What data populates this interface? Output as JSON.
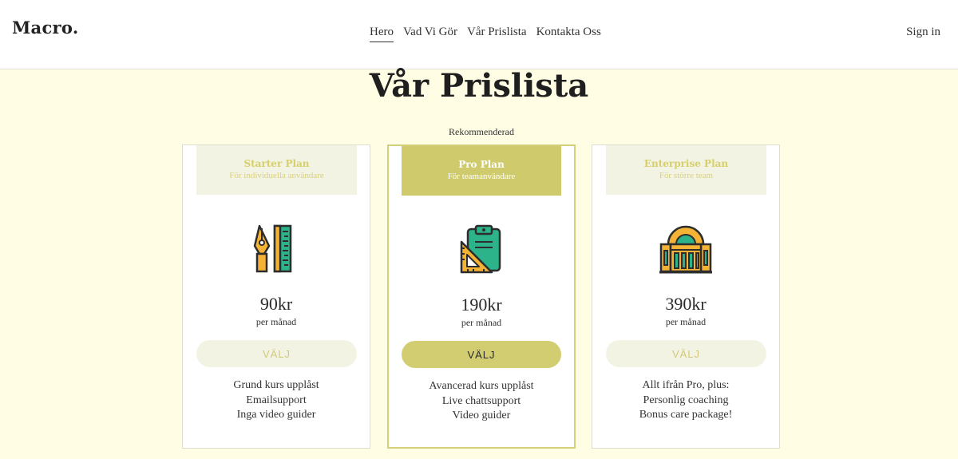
{
  "brand": {
    "logo": "Macro."
  },
  "nav": {
    "items": [
      {
        "label": "Hero"
      },
      {
        "label": "Vad Vi Gör"
      },
      {
        "label": "Vår Prislista"
      },
      {
        "label": "Kontakta Oss"
      }
    ],
    "active_index": 0,
    "sign_in": "Sign in"
  },
  "pricing": {
    "title": "Vår Prislista",
    "recommended_label": "Rekommenderad",
    "plans": [
      {
        "name": "Starter Plan",
        "subtitle": "För individuella användare",
        "icon": "pen-ruler-icon",
        "price": "90kr",
        "period": "per månad",
        "button": "VÄLJ",
        "features": [
          "Grund kurs upplåst",
          "Emailsupport",
          "Inga video guider"
        ]
      },
      {
        "name": "Pro Plan",
        "subtitle": "För teamanvändare",
        "icon": "clipboard-set-square-icon",
        "price": "190kr",
        "period": "per månad",
        "button": "VÄLJ",
        "features": [
          "Avancerad kurs upplåst",
          "Live chattsupport",
          "Video guider"
        ]
      },
      {
        "name": "Enterprise Plan",
        "subtitle": "För större team",
        "icon": "building-icon",
        "price": "390kr",
        "period": "per månad",
        "button": "VÄLJ",
        "features": [
          "Allt ifrån Pro, plus:",
          "Personlig coaching",
          "Bonus care package!"
        ]
      }
    ]
  },
  "colors": {
    "page_bg": "#fffde4",
    "accent": "#cfcb6c",
    "accent_light": "#f3f3e4",
    "icon_orange": "#f5b335",
    "icon_green": "#2cb38a",
    "outline": "#2d2d2d"
  }
}
